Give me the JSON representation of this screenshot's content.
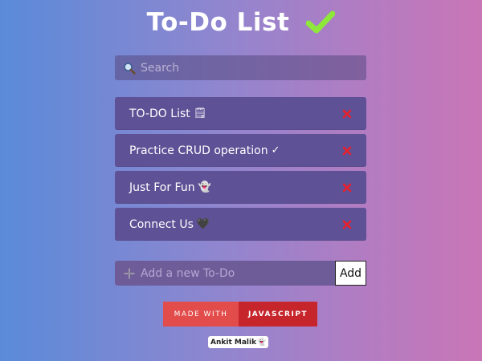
{
  "header": {
    "title": "To-Do List",
    "title_icon": "checkmark-icon",
    "check_color": "#8ee83a"
  },
  "search": {
    "placeholder": "Search",
    "icon": "search-icon"
  },
  "todos": [
    {
      "text": "TO-DO List",
      "emoji": "🗒"
    },
    {
      "text": "Practice CRUD operation",
      "emoji": "✓"
    },
    {
      "text": "Just For Fun",
      "emoji": "👻"
    },
    {
      "text": "Connect Us",
      "emoji": "🖤"
    }
  ],
  "delete_icon": "close-icon",
  "delete_color": "#e8202a",
  "add": {
    "placeholder": "Add a new To-Do",
    "button_label": "Add",
    "icon": "plus-icon"
  },
  "badge": {
    "left": "Made with",
    "right": "JavaScript"
  },
  "author": {
    "name": "Ankit Malik",
    "emoji": "👻"
  },
  "colors": {
    "item_bg": "#5e5196",
    "gradient_left": "#5a8bd9",
    "gradient_right": "#c976b6"
  }
}
